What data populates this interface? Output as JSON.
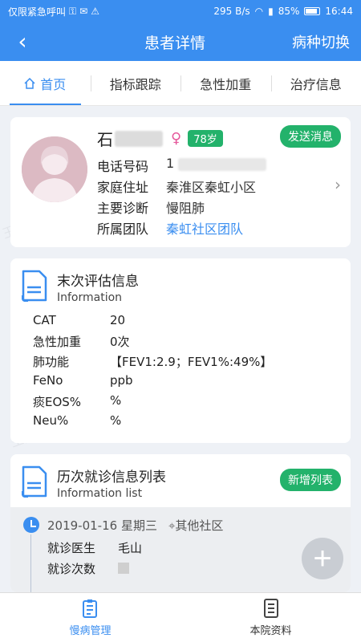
{
  "status": {
    "left": "仅限紧急呼叫",
    "speed": "295 B/s",
    "battery": "85%",
    "time": "16:44"
  },
  "nav": {
    "back": "‹",
    "title": "患者详情",
    "switch_label": "病种切换"
  },
  "tabs": [
    "首页",
    "指标跟踪",
    "急性加重",
    "治疗信息"
  ],
  "patient": {
    "name": "石",
    "age": "78岁",
    "send_button": "发送消息",
    "rows": [
      {
        "label": "电话号码",
        "value": "1"
      },
      {
        "label": "家庭住址",
        "value": "秦淮区秦虹小区"
      },
      {
        "label": "主要诊断",
        "value": "慢阻肺"
      },
      {
        "label": "所属团队",
        "value": "秦虹社区团队"
      }
    ]
  },
  "assessment": {
    "title": "末次评估信息",
    "subtitle": "Information",
    "items": [
      {
        "k": "CAT",
        "v": "20"
      },
      {
        "k": "急性加重",
        "v": "0次"
      },
      {
        "k": "肺功能",
        "v": "【FEV1:2.9；FEV1%:49%】"
      },
      {
        "k": "FeNo",
        "v": "ppb"
      },
      {
        "k": "痰EOS%",
        "v": "%"
      },
      {
        "k": "Neu%",
        "v": "%"
      }
    ]
  },
  "visits": {
    "title": "历次就诊信息列表",
    "subtitle": "Information list",
    "add_button": "新增列表",
    "entry": {
      "date": "2019-01-16 星期三",
      "place": "其他社区",
      "doctor_label": "就诊医生",
      "doctor": "毛山",
      "count_label": "就诊次数"
    }
  },
  "fab": "+",
  "bottom_nav": [
    "慢病管理",
    "本院资料"
  ],
  "watermark": "王陆静001011"
}
